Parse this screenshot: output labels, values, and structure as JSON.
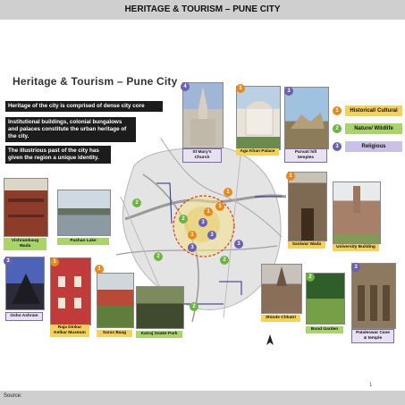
{
  "header": {
    "title": "HERITAGE & TOURISM – PUNE CITY"
  },
  "slide": {
    "title": "Heritage & Tourism – Pune City",
    "text_boxes": [
      "Heritage of the city is comprised of dense city core",
      "Institutional buildings, colonial bungalows and palaces constitute the urban heritage of the city.",
      "The illustrious past of the city has given the region a unique identity."
    ]
  },
  "legend": [
    {
      "num": "1",
      "label": "Historical/ Cultural",
      "color": "#e58a1f"
    },
    {
      "num": "2",
      "label": "Nature/ Wildlife",
      "color": "#6cb33f"
    },
    {
      "num": "3",
      "label": "Religious",
      "color": "#6a5fb0"
    }
  ],
  "sites": {
    "st_marys": {
      "num": "4",
      "label": "St Mary's Church"
    },
    "aga_khan": {
      "num": "1",
      "label": "Aga Khan Palace"
    },
    "parvati": {
      "num": "3",
      "label": "Parvati hill temples"
    },
    "vishrambaug": {
      "num": "",
      "label": "Vishrambaug Wada"
    },
    "pashan": {
      "num": "",
      "label": "Pashan Lake"
    },
    "shaniwar": {
      "num": "1",
      "label": "Saniwar Wada"
    },
    "university": {
      "num": "",
      "label": "University Building"
    },
    "osho": {
      "num": "3",
      "label": "Osho Ashram"
    },
    "kelkar": {
      "num": "1",
      "label": "Raja Dinkar Kelkar Museum"
    },
    "saras": {
      "num": "1",
      "label": "Saras Baag"
    },
    "katraj": {
      "num": "",
      "label": "Katraj Snake Park"
    },
    "shinde": {
      "num": "",
      "label": "Shinde Chhatri"
    },
    "bund": {
      "num": "2",
      "label": "Bund Garden"
    },
    "pataleswar": {
      "num": "3",
      "label": "Pataleswar Cave & temple"
    }
  },
  "map_markers": [
    "1",
    "2",
    "3",
    "1",
    "3",
    "1",
    "2",
    "3",
    "1",
    "2",
    "2",
    "3",
    "2"
  ],
  "footer": {
    "source": "Source:",
    "page": "1"
  }
}
